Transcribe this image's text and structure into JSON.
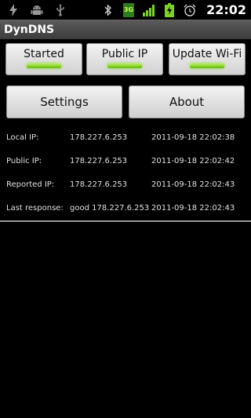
{
  "status_bar": {
    "icons": [
      "flash-icon",
      "android-icon",
      "usb-icon",
      "bluetooth-icon",
      "data-3g-icon",
      "signal-icon",
      "battery-charging-icon",
      "alarm-icon"
    ],
    "network_label": "3G",
    "time": "22:02"
  },
  "app": {
    "title": "DynDNS"
  },
  "toggles": [
    {
      "label": "Started",
      "on": true
    },
    {
      "label": "Public IP",
      "on": true
    },
    {
      "label": "Update Wi-Fi",
      "on": true
    }
  ],
  "buttons": {
    "settings": "Settings",
    "about": "About"
  },
  "info_rows": [
    {
      "label": "Local IP:",
      "value": "178.227.6.253",
      "timestamp": "2011-09-18 22:02:38"
    },
    {
      "label": "Public IP:",
      "value": "178.227.6.253",
      "timestamp": "2011-09-18 22:02:42"
    },
    {
      "label": "Reported IP:",
      "value": "178.227.6.253",
      "timestamp": "2011-09-18 22:02:43"
    },
    {
      "label": "Last response:",
      "value": "good 178.227.6.253",
      "timestamp": "2011-09-18 22:02:43"
    }
  ],
  "colors": {
    "indicator_on": "#7ed321",
    "titlebar": "#4a4a4a",
    "background": "#000000"
  }
}
